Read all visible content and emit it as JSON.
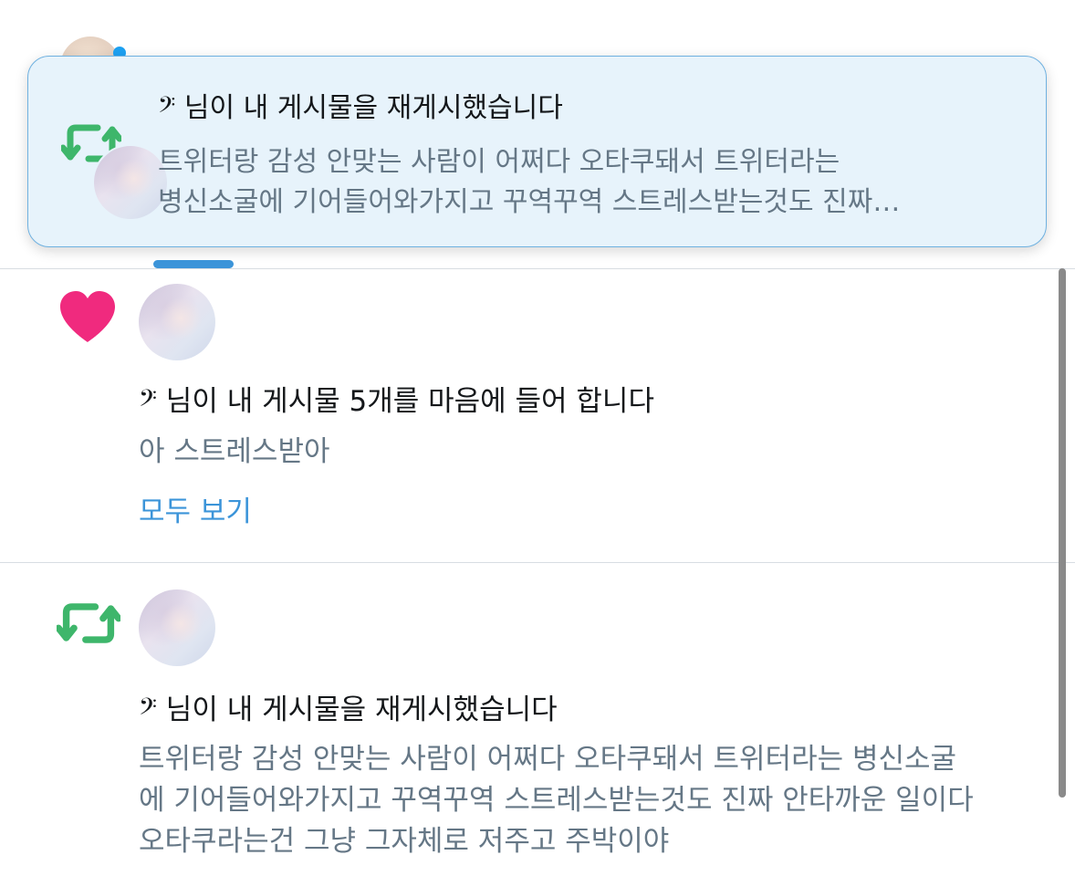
{
  "toast": {
    "sender": "𝄢",
    "title": "님이 내 게시물을 재게시했습니다",
    "body_lines": [
      "트위터랑 감성 안맞는 사람이 어쩌다 오타쿠돼서 트위터라는",
      "병신소굴에 기어들어와가지고 꾸역꾸역 스트레스받는것도 진짜…"
    ],
    "icon": "retweet-icon"
  },
  "notifications": [
    {
      "type": "like",
      "icon": "heart-icon",
      "icon_color": "#f02a7e",
      "sender": "𝄢",
      "title": "님이 내 게시물 5개를 마음에 들어 합니다",
      "text_lines": [
        "아 스트레스받아"
      ],
      "see_all": "모두 보기"
    },
    {
      "type": "retweet",
      "icon": "retweet-icon",
      "icon_color": "#3eb66b",
      "sender": "𝄢",
      "title": "님이 내 게시물을 재게시했습니다",
      "text_lines": [
        "트위터랑 감성 안맞는 사람이 어쩌다 오타쿠돼서 트위터라는 병신소굴",
        "에 기어들어와가지고 꾸역꾸역 스트레스받는것도 진짜 안타까운 일이다",
        "오타쿠라는건 그냥 그자체로 저주고 주박이야"
      ]
    }
  ],
  "colors": {
    "accent": "#3b94d9",
    "like": "#f02a7e",
    "retweet": "#3eb66b",
    "muted_text": "#657786"
  }
}
